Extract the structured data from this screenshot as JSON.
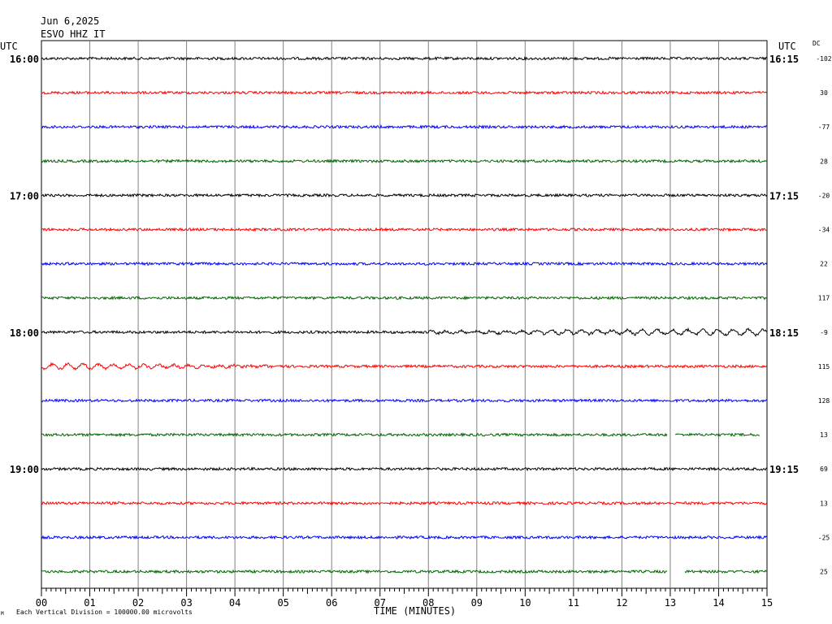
{
  "header": {
    "date": "Jun 6,2025",
    "station": "ESVO HHZ IT",
    "utc_left": "UTC",
    "utc_right": "UTC",
    "dc_label": "DC"
  },
  "footer": {
    "note": "Each Vertical Division = 100000.00 microvolts",
    "xlabel": "TIME (MINUTES)"
  },
  "chart_data": {
    "type": "line",
    "title": "",
    "xlabel": "TIME (MINUTES)",
    "ylabel": "",
    "xlim": [
      0,
      15
    ],
    "x_ticks": [
      "00",
      "01",
      "02",
      "03",
      "04",
      "05",
      "06",
      "07",
      "08",
      "09",
      "10",
      "11",
      "12",
      "13",
      "14",
      "15"
    ],
    "grid": true,
    "line_colors": [
      "#000000",
      "#ff0000",
      "#0000ff",
      "#006400"
    ],
    "left_hour_labels": [
      {
        "row": 0,
        "text": "16:00"
      },
      {
        "row": 4,
        "text": "17:00"
      },
      {
        "row": 8,
        "text": "18:00"
      },
      {
        "row": 12,
        "text": "19:00"
      }
    ],
    "right_hour_labels": [
      {
        "row": 0,
        "text": "16:15"
      },
      {
        "row": 4,
        "text": "17:15"
      },
      {
        "row": 8,
        "text": "18:15"
      },
      {
        "row": 12,
        "text": "19:15"
      }
    ],
    "dc_offsets": [
      "-102",
      "30",
      "-77",
      "28",
      "-20",
      "-34",
      "22",
      "117",
      "-9",
      "115",
      "128",
      "13",
      "69",
      "13",
      "-25",
      "25"
    ],
    "gaps": [
      {
        "row": 11,
        "from_minute": 12.95,
        "to_minute": 13.1
      },
      {
        "row": 11,
        "from_minute": 14.85,
        "to_minute": 15
      },
      {
        "row": 15,
        "from_minute": 12.95,
        "to_minute": 13.3
      }
    ],
    "events": [
      {
        "row": 8,
        "from_minute": 8.0,
        "to_minute": 15.0,
        "note": "surface wave oscillation"
      },
      {
        "row": 9,
        "from_minute": 0.0,
        "to_minute": 5.0,
        "note": "oscillation continuing"
      }
    ]
  }
}
